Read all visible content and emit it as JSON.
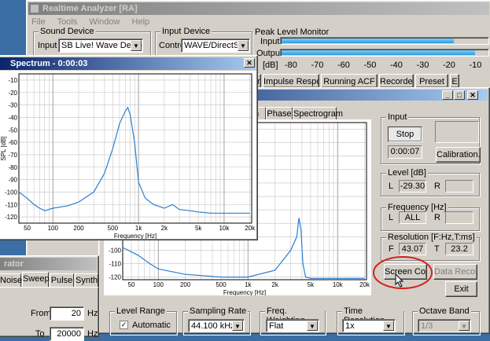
{
  "main_window": {
    "title": "Realtime Analyzer [RA]",
    "menu": [
      "File",
      "Tools",
      "Window",
      "Help"
    ]
  },
  "sound_device": {
    "group_label": "Sound Device",
    "input_label": "Input",
    "input_value": "SB Live! Wave Device"
  },
  "input_device": {
    "group_label": "Input Device",
    "control_label": "Control",
    "control_value": "WAVE/DirectS"
  },
  "peak_level": {
    "group_label": "Peak Level Monitor",
    "input_label": "Input",
    "output_label": "Output",
    "unit_label": "[dB]",
    "scale": [
      "-80",
      "-70",
      "-60",
      "-50",
      "-40",
      "-30",
      "-20",
      "-10"
    ],
    "input_fill": 0.83,
    "output_fill": 0.93
  },
  "function_tabs": [
    "zer",
    "Impulse Response",
    "Running ACF",
    "Recorder",
    "Preset",
    "E"
  ],
  "analyzer_tabs": [
    "n",
    "Phase",
    "Spectrogram"
  ],
  "input_panel": {
    "group_label": "Input",
    "stop_label": "Stop",
    "time_value": "0:00:07",
    "calibration_label": "Calibration..."
  },
  "level_panel": {
    "group_label": "Level [dB]",
    "l_label": "L",
    "l_value": "-29.30",
    "r_label": "R"
  },
  "frequency_panel": {
    "group_label": "Frequency [Hz]",
    "l_label": "L",
    "l_value": "ALL",
    "r_label": "R"
  },
  "resolution_panel": {
    "group_label": "Resolution [F:Hz,T:ms]",
    "f_label": "F",
    "f_value": "43.07",
    "t_label": "T",
    "t_value": "23.2"
  },
  "screen_copy_label": "Screen Copy",
  "data_record_label": "Data Record",
  "exit_label": "Exit",
  "bottom_controls": {
    "level_range": {
      "label": "Level Range",
      "automatic": "Automatic"
    },
    "sampling_rate": {
      "label": "Sampling Rate",
      "value": "44.100 kHz"
    },
    "freq_weighting": {
      "label": "Freq. Weighting",
      "value": "Flat"
    },
    "time_resolution": {
      "label": "Time Resolution",
      "value": "1x"
    },
    "octave_band": {
      "label": "Octave Band",
      "value": "1/3"
    }
  },
  "generator": {
    "title": "rator",
    "tabs": [
      "Noise",
      "Sweep",
      "Pulse",
      "Synth"
    ],
    "from_label": "From",
    "from_value": "20",
    "from_unit": "Hz",
    "to_label": "To",
    "to_value": "20000",
    "to_unit": "Hz"
  },
  "spectrum_window": {
    "title": "Spectrum - 0:00:03",
    "ylabel": "SPL [dB]",
    "xlabel": "Frequency [Hz]",
    "y_ticks": [
      "-10",
      "-20",
      "-30",
      "-40",
      "-50",
      "-60",
      "-70",
      "-80",
      "-90",
      "-100",
      "-110",
      "-120"
    ],
    "x_ticks": [
      "50",
      "100",
      "200",
      "500",
      "1k",
      "2k",
      "5k",
      "10k",
      "20k"
    ]
  },
  "main_plot": {
    "xlabel": "Frequency [Hz]",
    "y_ticks": [
      "-100",
      "-110",
      "-120"
    ],
    "x_ticks": [
      "50",
      "100",
      "200",
      "500",
      "1k",
      "2k",
      "5k",
      "10k",
      "20k"
    ]
  },
  "chart_data": [
    {
      "type": "line",
      "ylabel": "SPL [dB]",
      "xlabel": "Frequency [Hz]",
      "xscale": "log",
      "xlim": [
        40,
        21000
      ],
      "ylim": [
        -125,
        -5
      ],
      "grid": true,
      "series": [
        {
          "x": [
            40,
            50,
            60,
            70,
            80,
            100,
            150,
            200,
            300,
            400,
            500,
            600,
            700,
            750,
            800,
            900,
            1000,
            1200,
            1500,
            2000,
            2500,
            3000,
            4000,
            5000,
            7000,
            10000,
            15000,
            20000
          ],
          "y": [
            -100,
            -105,
            -110,
            -113,
            -115,
            -113,
            -111,
            -108,
            -100,
            -85,
            -65,
            -45,
            -35,
            -32,
            -38,
            -60,
            -92,
            -105,
            -110,
            -113,
            -110,
            -114,
            -115,
            -116,
            -117,
            -117,
            -117,
            -117
          ]
        }
      ]
    },
    {
      "type": "line",
      "xlabel": "Frequency [Hz]",
      "xscale": "log",
      "xlim": [
        40,
        21000
      ],
      "ylim": [
        -122,
        -5
      ],
      "grid": true,
      "series": [
        {
          "x": [
            40,
            60,
            80,
            100,
            200,
            500,
            1000,
            2000,
            3000,
            3500,
            3700,
            3900,
            4100,
            4400,
            5000,
            7000,
            10000,
            20000
          ],
          "y": [
            -98,
            -104,
            -110,
            -114,
            -118,
            -120,
            -120,
            -115,
            -100,
            -90,
            -76,
            -85,
            -110,
            -120,
            -121,
            -121,
            -121,
            -121
          ]
        }
      ]
    }
  ]
}
